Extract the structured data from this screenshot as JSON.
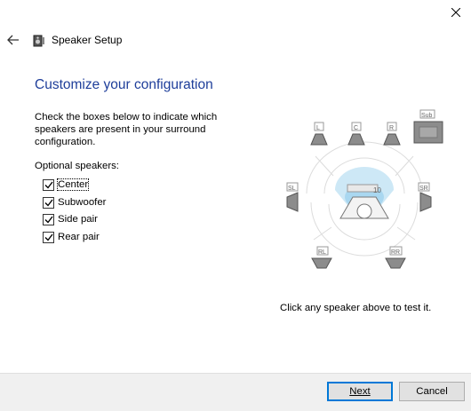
{
  "window": {
    "close_glyph": "✕"
  },
  "header": {
    "title": "Speaker Setup",
    "back_icon": "arrow-left-icon",
    "app_icon": "speaker-setup-icon"
  },
  "main": {
    "page_title": "Customize your configuration",
    "instructions": "Check the boxes below to indicate which speakers are present in your surround configuration.",
    "optional_label": "Optional speakers:",
    "checkboxes": [
      {
        "label": "Center",
        "checked": true
      },
      {
        "label": "Subwoofer",
        "checked": true
      },
      {
        "label": "Side pair",
        "checked": true
      },
      {
        "label": "Rear pair",
        "checked": true
      }
    ]
  },
  "diagram": {
    "speakers": {
      "left": "L",
      "center": "C",
      "right": "R",
      "sub": "Sub",
      "side_left": "SL",
      "side_right": "SR",
      "rear_left": "RL",
      "rear_right": "RR"
    },
    "tv_label": "10",
    "hint": "Click any speaker above to test it."
  },
  "footer": {
    "next_label": "Next",
    "cancel_label": "Cancel"
  },
  "colors": {
    "title": "#1e3e9a",
    "accent": "#0078d7",
    "sweet_spot": "#cde8f6"
  }
}
